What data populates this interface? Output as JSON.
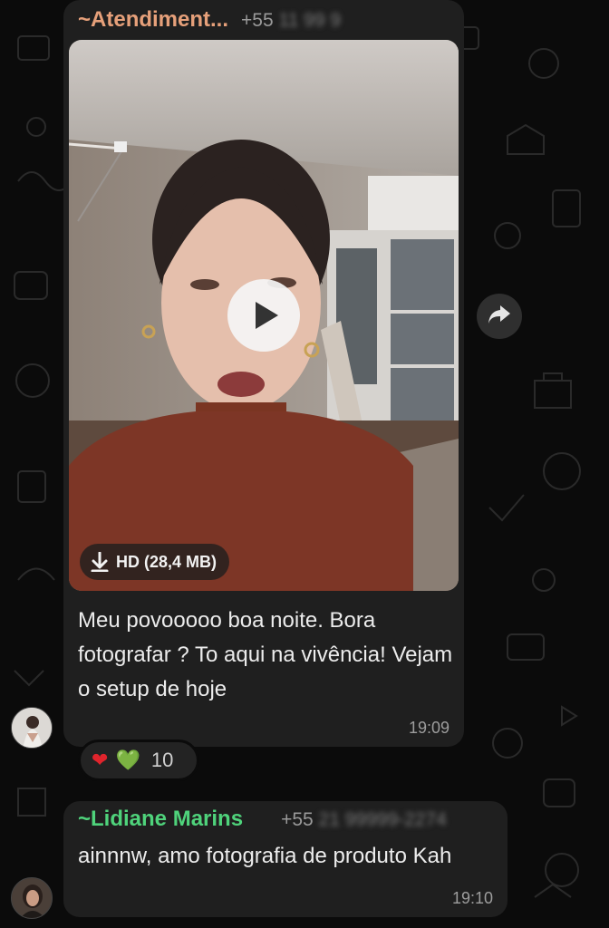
{
  "colors": {
    "background": "#0b0b0b",
    "bubble": "#1f1f1f",
    "sender1_name": "#e6a07a",
    "sender2_name": "#4fd37b",
    "timestamp": "#9d9d9d"
  },
  "messages": [
    {
      "sender_name": "~Atendiment...",
      "sender_phone_prefix": "+55",
      "sender_phone_obscured": "11 99 9",
      "video": {
        "download_label": "HD (28,4 MB)",
        "play_icon": "play-icon",
        "download_icon": "download-arrow-icon"
      },
      "text": "Meu povooooo boa noite. Bora fotografar ? To aqui na vivência! Vejam o setup de hoje",
      "time": "19:09",
      "reactions": {
        "emojis": [
          "❤",
          "💚"
        ],
        "count": "10"
      }
    },
    {
      "sender_name": "~Lidiane Marins",
      "sender_phone_prefix": "+55",
      "sender_phone_obscured": "21 99999-2274",
      "text": "ainnnw, amo fotografia de produto Kah",
      "time": "19:10"
    }
  ],
  "forward_icon": "forward-arrow-icon"
}
